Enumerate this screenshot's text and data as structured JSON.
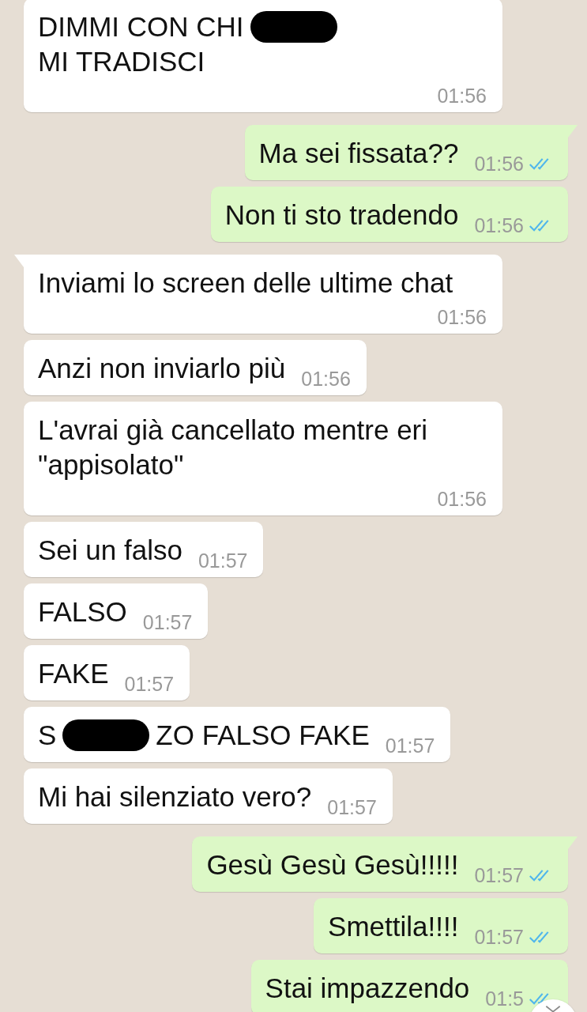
{
  "messages": [
    {
      "kind": "incoming",
      "tail": false,
      "segments": [
        {
          "kind": "text",
          "text": "DIMMI CON CHI"
        },
        {
          "kind": "redacted"
        },
        {
          "kind": "text",
          "text": "MI TRADISCI"
        }
      ],
      "time": "01:56"
    },
    {
      "kind": "outgoing",
      "tail": true,
      "text": "Ma sei fissata??",
      "time": "01:56",
      "read": true
    },
    {
      "kind": "outgoing",
      "tail": false,
      "text": "Non ti sto tradendo",
      "time": "01:56",
      "read": true
    },
    {
      "kind": "incoming",
      "tail": true,
      "text": "Inviami lo screen delle ultime chat",
      "time": "01:56"
    },
    {
      "kind": "incoming",
      "tail": false,
      "text": "Anzi non inviarlo più",
      "time": "01:56"
    },
    {
      "kind": "incoming",
      "tail": false,
      "text": "L'avrai già cancellato mentre eri \"appisolato\"",
      "time": "01:56"
    },
    {
      "kind": "incoming",
      "tail": false,
      "text": "Sei un falso",
      "time": "01:57"
    },
    {
      "kind": "incoming",
      "tail": false,
      "text": "FALSO",
      "time": "01:57"
    },
    {
      "kind": "incoming",
      "tail": false,
      "text": "FAKE",
      "time": "01:57"
    },
    {
      "kind": "incoming",
      "tail": false,
      "segments": [
        {
          "kind": "text",
          "text": "S"
        },
        {
          "kind": "redacted"
        },
        {
          "kind": "text",
          "text": "ZO FALSO FAKE"
        }
      ],
      "time": "01:57"
    },
    {
      "kind": "incoming",
      "tail": false,
      "text": "Mi hai silenziato vero?",
      "time": "01:57"
    },
    {
      "kind": "outgoing",
      "tail": true,
      "text": "Gesù Gesù Gesù!!!!!",
      "time": "01:57",
      "read": true
    },
    {
      "kind": "outgoing",
      "tail": false,
      "text": "Smettila!!!!",
      "time": "01:57",
      "read": true
    },
    {
      "kind": "outgoing",
      "tail": false,
      "text": "Stai impazzendo",
      "time": "01:5",
      "read": true
    }
  ],
  "scroll_down_button": {
    "visible": true
  }
}
